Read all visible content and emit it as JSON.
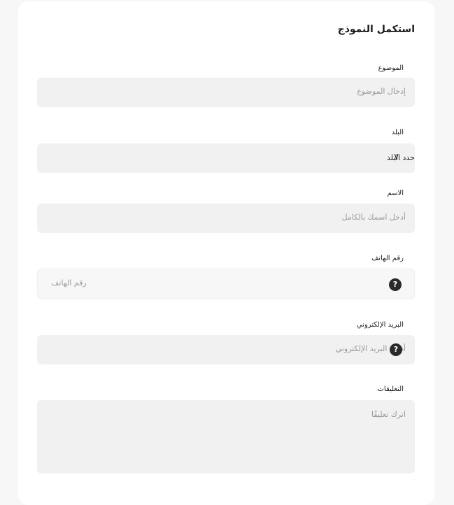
{
  "form": {
    "title": "استكمل النموذج",
    "fields": {
      "subject": {
        "label": "الموضوع",
        "placeholder": "إدخال الموضوع"
      },
      "country": {
        "label": "البلد",
        "value": "حدد البلد"
      },
      "name": {
        "label": "الاسم",
        "placeholder": "أدخل اسمك بالكامل"
      },
      "phone": {
        "label": "رقم الهاتف",
        "placeholder": "رقم الهاتف",
        "help_icon": "?"
      },
      "email": {
        "label": "البريد الإلكتروني",
        "placeholder": "أدخل البريد الإلكتروني",
        "help_icon": "?"
      },
      "comments": {
        "label": "التعليقات",
        "placeholder": "اترك تعليقًا"
      }
    }
  },
  "colors": {
    "page_bg": "#f7f7f7",
    "card_bg": "#ffffff",
    "field_bg": "#f1f1f1",
    "placeholder": "#9a9a9a",
    "help_icon_bg": "#2a2a2a"
  }
}
